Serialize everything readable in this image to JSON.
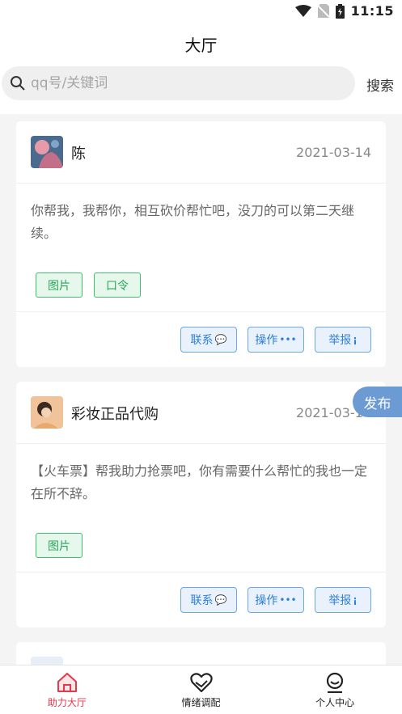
{
  "status_bar": {
    "time": "11:15"
  },
  "header": {
    "title": "大厅"
  },
  "search": {
    "placeholder": "qq号/关键词",
    "button_label": "搜索"
  },
  "posts": [
    {
      "name": "陈",
      "date": "2021-03-14",
      "text": "你帮我，我帮你，相互砍价帮忙吧，没刀的可以第二天继续。",
      "tags": [
        "图片",
        "口令"
      ],
      "actions": {
        "contact": "联系",
        "operate": "操作",
        "report": "举报"
      }
    },
    {
      "name": "彩妆正品代购",
      "date": "2021-03-14",
      "text": "【火车票】帮我助力抢票吧，你有需要什么帮忙的我也一定在所不辞。",
      "tags": [
        "图片"
      ],
      "actions": {
        "contact": "联系",
        "operate": "操作",
        "report": "举报"
      }
    }
  ],
  "fab": {
    "label": "发布"
  },
  "tabbar": {
    "items": [
      {
        "label": "助力大厅",
        "icon": "home-icon",
        "active": true
      },
      {
        "label": "情绪调配",
        "icon": "heart-hands-icon",
        "active": false
      },
      {
        "label": "个人中心",
        "icon": "person-icon",
        "active": false
      }
    ],
    "active_color": "#e4394a"
  }
}
